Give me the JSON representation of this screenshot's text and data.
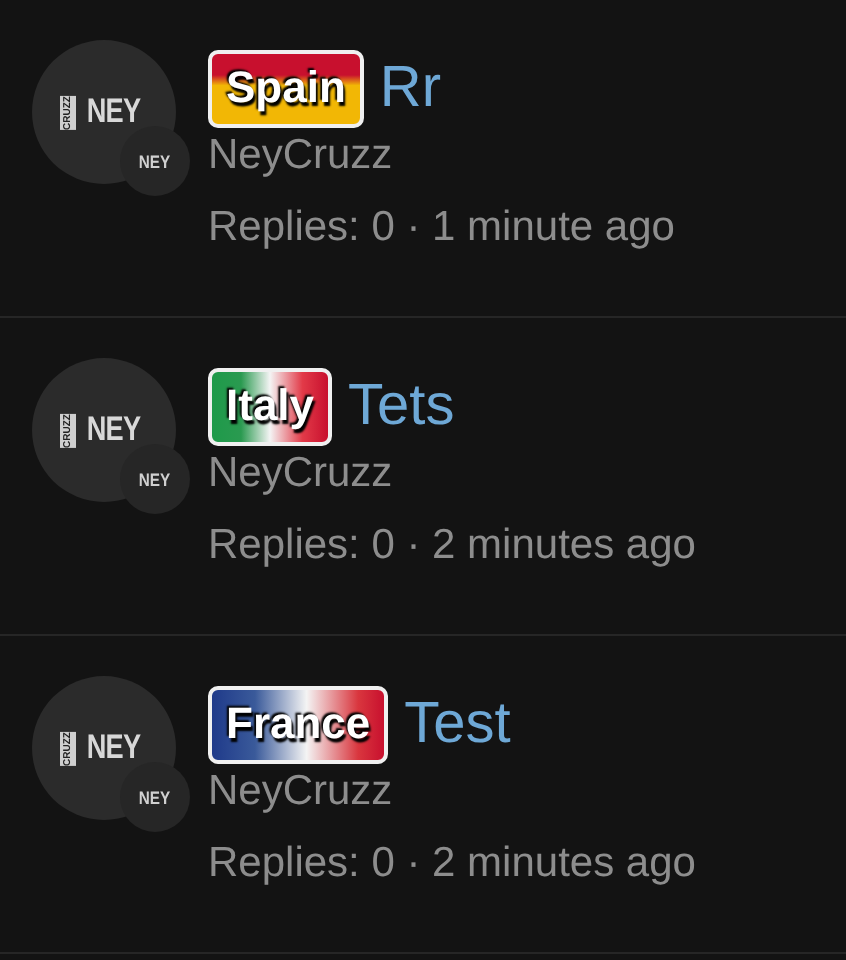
{
  "threads": [
    {
      "avatar": {
        "logo": "NEY",
        "side": "CRUZZ",
        "badge_logo": "NEY"
      },
      "prefix": {
        "label": "Spain",
        "kind": "spain"
      },
      "title": "Rr",
      "author": "NeyCruzz",
      "meta": "Replies: 0 · 1 minute ago"
    },
    {
      "avatar": {
        "logo": "NEY",
        "side": "CRUZZ",
        "badge_logo": "NEY"
      },
      "prefix": {
        "label": "Italy",
        "kind": "italy"
      },
      "title": "Tets",
      "author": "NeyCruzz",
      "meta": "Replies: 0 · 2 minutes ago"
    },
    {
      "avatar": {
        "logo": "NEY",
        "side": "CRUZZ",
        "badge_logo": "NEY"
      },
      "prefix": {
        "label": "France",
        "kind": "france"
      },
      "title": "Test",
      "author": "NeyCruzz",
      "meta": "Replies: 0 · 2 minutes ago"
    }
  ]
}
